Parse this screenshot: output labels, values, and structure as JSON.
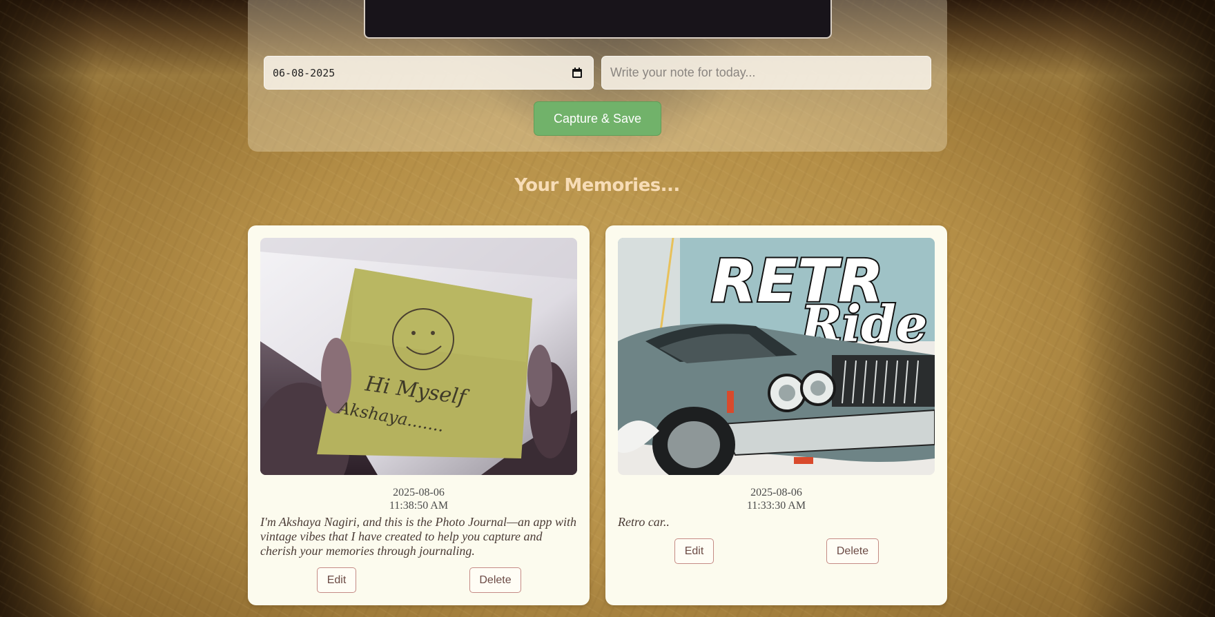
{
  "capture": {
    "date_value": "06-08-2025",
    "note_placeholder": "Write your note for today...",
    "save_label": "Capture & Save"
  },
  "memories": {
    "title": "Your Memories...",
    "cards": [
      {
        "date": "2025-08-06",
        "time": "11:38:50 AM",
        "note": "I'm Akshaya Nagiri, and this is the Photo Journal—an app with vintage vibes that I have created to help you capture and cherish your memories through journaling.",
        "edit_label": "Edit",
        "delete_label": "Delete",
        "photo_text": [
          "Hi Myself",
          "Akshaya......."
        ]
      },
      {
        "date": "2025-08-06",
        "time": "11:33:30 AM",
        "note": "Retro car..",
        "edit_label": "Edit",
        "delete_label": "Delete",
        "photo_text": [
          "RETR",
          "Ride"
        ]
      }
    ]
  },
  "colors": {
    "accent_green": "#71b26a",
    "title_color": "#f7dcb6",
    "card_bg": "#fcfbee"
  }
}
